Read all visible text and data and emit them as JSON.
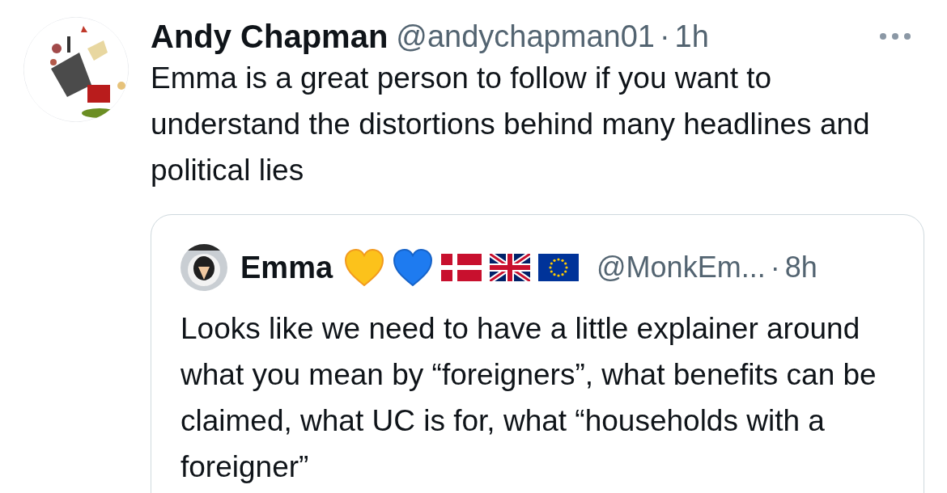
{
  "tweet": {
    "author": {
      "name": "Andy Chapman",
      "handle": "@andychapman01",
      "separator": "·",
      "time": "1h"
    },
    "text": "Emma is a great person to follow if you want to understand the distortions behind many headlines and political lies",
    "quote": {
      "author": {
        "name": "Emma",
        "handle": "@MonkEm...",
        "separator": "·",
        "time": "8h"
      },
      "text": "Looks like we need to have a little explainer around what you mean by “foreigners”, what benefits can be claimed, what UC is for, what “households with a foreigner”"
    }
  }
}
